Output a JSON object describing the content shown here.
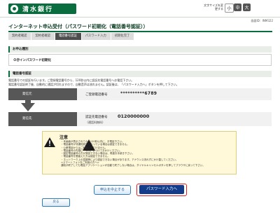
{
  "header": {
    "bank_name": "清水銀行",
    "font_size_label": "文字サイズを変更する",
    "font_sizes": [
      "小",
      "中",
      "大"
    ],
    "screen_id": "画面ID：INM322"
  },
  "title": "インターネット申込受付（パスワード初期化（電話番号認証））",
  "steps": [
    "契約者確認",
    "契約者確認",
    "電話番号認証",
    "パスワード入力",
    "初期化完了"
  ],
  "application_type": {
    "heading": "お申込種別",
    "value": "Ｏ＠インパスワード初期化"
  },
  "phone_auth": {
    "heading": "電話番号認証",
    "instructions": [
      "電話番号での認証を行います。ご登録電話番号から、120秒以内に認証先電話番号へお電話下さい。",
      "電話番号認証終了後、自動的に通話が切れますので、自動音声は流れません。認証後は、「パスワード入力へ」ボタンを押して下さい。"
    ],
    "caller_label": "発信元",
    "caller_field": "ご登録電話番号",
    "caller_value": "**********6789",
    "dest_label": "発信先",
    "dest_field": "認証先電話番号",
    "dest_value": "0120000000",
    "dest_note": "（通話料無料）"
  },
  "caution": {
    "title": "注意",
    "items": [
      "・本画面が表示されてから120秒以内に、お電話下さい。",
      "・電話番号が非通知設定になっている場合は認証できません。",
      "・公衆電話からはご利用いただけません。",
      "・電話番号の先頭に「186」をつけておかけください。",
      "・固定電話番号の方が発信できない場合は、再度お手続き下さい。",
      "・電話番号を間違えた方は認証できません。",
      "・ネットワーク上の混雑等により認証できない場合があります。アナウンス流れずにかけ直してください。",
      "<スマートフォンをご利用の方へ>",
      "通知が終了しても電話アプリケーションが自動で終了しない場合は、ダイヤルキャンセルボタンを押してブラウザに戻って下さい。"
    ]
  },
  "buttons": {
    "cancel": "申込を中止する",
    "next": "パスワード入力へ",
    "back": "戻る"
  }
}
